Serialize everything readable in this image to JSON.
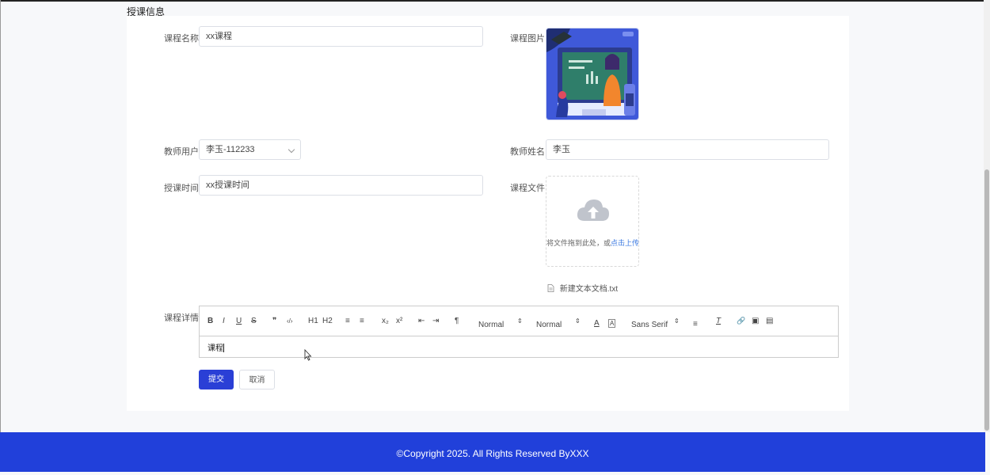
{
  "section_title": "授课信息",
  "form": {
    "course_name": {
      "label": "课程名称",
      "value": "xx课程"
    },
    "course_image": {
      "label": "课程图片"
    },
    "teacher_user": {
      "label": "教师用户",
      "value": "李玉-112233"
    },
    "teacher_name": {
      "label": "教师姓名",
      "value": "李玉"
    },
    "teaching_time": {
      "label": "授课时间",
      "value": "xx授课时间"
    },
    "course_file": {
      "label": "课程文件",
      "upload_hint": "将文件拖到此处，或",
      "upload_link": "点击上传",
      "file_name": "新建文本文档.txt"
    },
    "course_detail": {
      "label": "课程详情",
      "toolbar": {
        "bold": "B",
        "italic": "I",
        "underline": "U",
        "strike": "S",
        "quote": "❞",
        "code": "‹/›",
        "h1": "H1",
        "h2": "H2",
        "ordered": "≡",
        "bullet": "≡",
        "sub": "x₂",
        "sup": "x²",
        "outdent": "⇤",
        "indent": "⇥",
        "direction": "¶",
        "size": "Normal",
        "header": "Normal",
        "font": "Sans Serif",
        "color": "A",
        "background": "A",
        "align": "≡",
        "clean": "T",
        "link": "🔗",
        "image": "▣",
        "video": "▤"
      },
      "content": "课程"
    }
  },
  "buttons": {
    "submit": "提交",
    "cancel": "取消"
  },
  "footer": "©Copyright 2025. All Rights Reserved ByXXX"
}
